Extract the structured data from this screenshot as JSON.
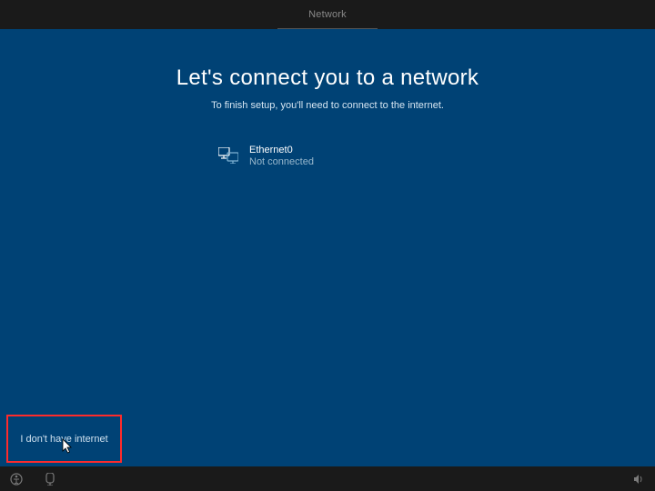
{
  "topbar": {
    "title": "Network"
  },
  "main": {
    "headline": "Let's connect you to a network",
    "subhead": "To finish setup, you'll need to connect to the internet."
  },
  "network": {
    "name": "Ethernet0",
    "status": "Not connected"
  },
  "footer": {
    "skip_label": "I don't have internet"
  }
}
